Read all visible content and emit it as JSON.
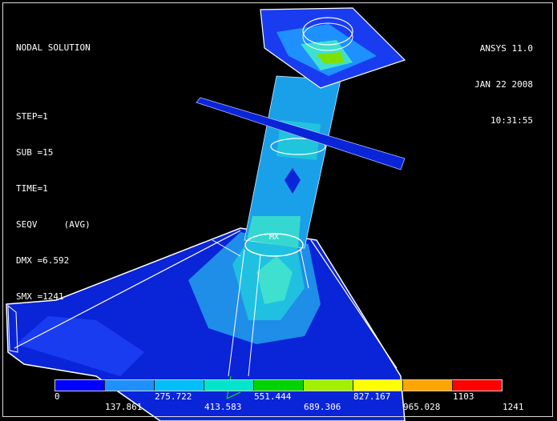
{
  "plot": {
    "title": "NODAL SOLUTION",
    "step": "STEP=1",
    "sub": "SUB =15",
    "time": "TIME=1",
    "seqv": "SEQV     (AVG)",
    "dmx": "DMX =6.592",
    "smx": "SMX =1241"
  },
  "stamp": {
    "version": "ANSYS 11.0",
    "date": "JAN 22 2008",
    "time": "10:31:55"
  },
  "markers": {
    "mx": "MX"
  },
  "legend": {
    "colors": [
      "#0000ff",
      "#1e90ff",
      "#00bfff",
      "#00e5cc",
      "#00d400",
      "#a0f000",
      "#ffff00",
      "#ffa500",
      "#ff0000"
    ],
    "ticks_top": [
      "0",
      "275.722",
      "551.444",
      "827.167",
      "1103"
    ],
    "ticks_bottom": [
      "137.861",
      "413.583",
      "689.306",
      "965.028",
      "1241"
    ]
  }
}
